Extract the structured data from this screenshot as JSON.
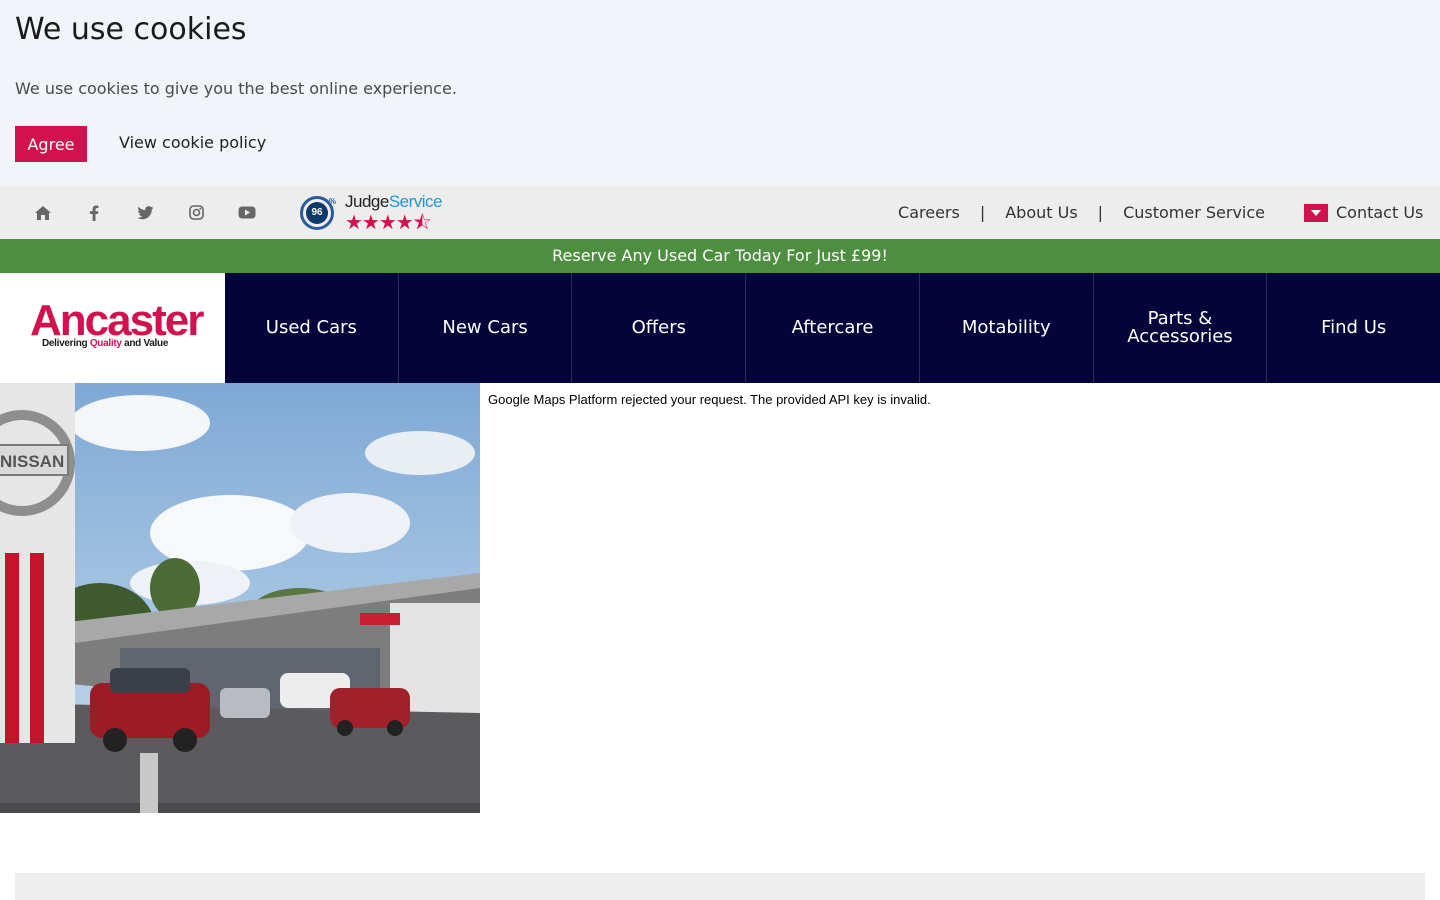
{
  "cookie_banner": {
    "title": "We use cookies",
    "message": "We use cookies to give you the best online experience.",
    "agree_label": "Agree",
    "policy_label": "View cookie policy"
  },
  "utility_bar": {
    "social_icons": [
      "home-icon",
      "facebook-icon",
      "twitter-icon",
      "instagram-icon",
      "youtube-icon"
    ],
    "judge_service": {
      "score": "96",
      "score_suffix": "%",
      "brand_prefix": "Judge",
      "brand_suffix": "Service",
      "stars": "★★★★⯪",
      "rating_stars": 4.5
    },
    "links": [
      "Careers",
      "About Us",
      "Customer Service"
    ],
    "separator": "|",
    "contact_label": "Contact Us"
  },
  "promo": {
    "text": "Reserve Any Used Car Today For Just £99!"
  },
  "header": {
    "logo_word": "Ancaster",
    "logo_tag_start": "Delivering ",
    "logo_tag_quality": "Quality",
    "logo_tag_end": " and Value",
    "nav": [
      {
        "label": "Used Cars"
      },
      {
        "label": "New Cars"
      },
      {
        "label": "Offers"
      },
      {
        "label": "Aftercare"
      },
      {
        "label": "Motability"
      },
      {
        "label": "Parts & Accessories"
      },
      {
        "label": "Find Us"
      }
    ]
  },
  "content": {
    "dealership_sign_text": "NISSAN",
    "map_error": "Google Maps Platform rejected your request. The provided API key is invalid."
  },
  "colors": {
    "brand_red": "#d2124f",
    "nav_bg": "#04043a",
    "promo_green": "#4e8e41",
    "cookie_bg": "#f1f4f8",
    "utility_bg": "#ededed"
  }
}
